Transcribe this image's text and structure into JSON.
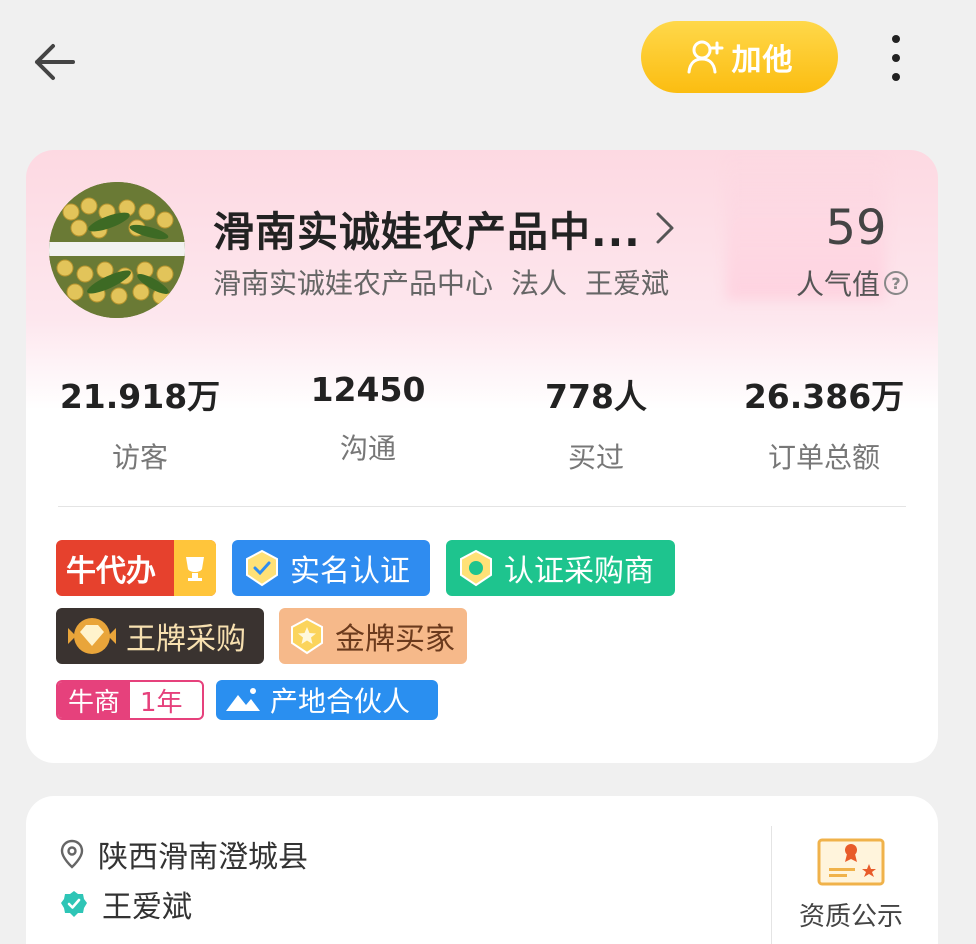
{
  "header": {
    "back_icon": "arrow-left-icon",
    "add_button_label": "加他",
    "more_icon": "more-vertical-icon"
  },
  "profile": {
    "avatar": "produce-photo",
    "name": "滑南实诚娃农产品中...",
    "company": "滑南实诚娃农产品中心",
    "role_label": "法人",
    "legal_person": "王爱斌",
    "popularity_value": "59",
    "popularity_label": "人气值"
  },
  "stats": [
    {
      "value": "21.918万",
      "label": "访客"
    },
    {
      "value": "12450",
      "label": "沟通"
    },
    {
      "value": "778人",
      "label": "买过"
    },
    {
      "value": "26.386万",
      "label": "订单总额"
    }
  ],
  "badges": {
    "niu_daiban": "牛代办",
    "real_name": "实名认证",
    "certified_buyer": "认证采购商",
    "ace_purchase": "王牌采购",
    "gold_buyer": "金牌买家",
    "niu_shang": "牛商",
    "niu_shang_years": "1年",
    "origin_partner": "产地合伙人"
  },
  "colors": {
    "accent_yellow": "#fbbd11",
    "badge_red": "#e6412d",
    "badge_blue": "#2f8cf0",
    "badge_green": "#1ec48e",
    "badge_dark": "#3a3330",
    "badge_gold": "#f6b98a",
    "badge_pink": "#e6417c"
  },
  "info": {
    "location": "陕西滑南澄城县",
    "verified_person": "王爱斌",
    "qualification_label": "资质公示"
  }
}
